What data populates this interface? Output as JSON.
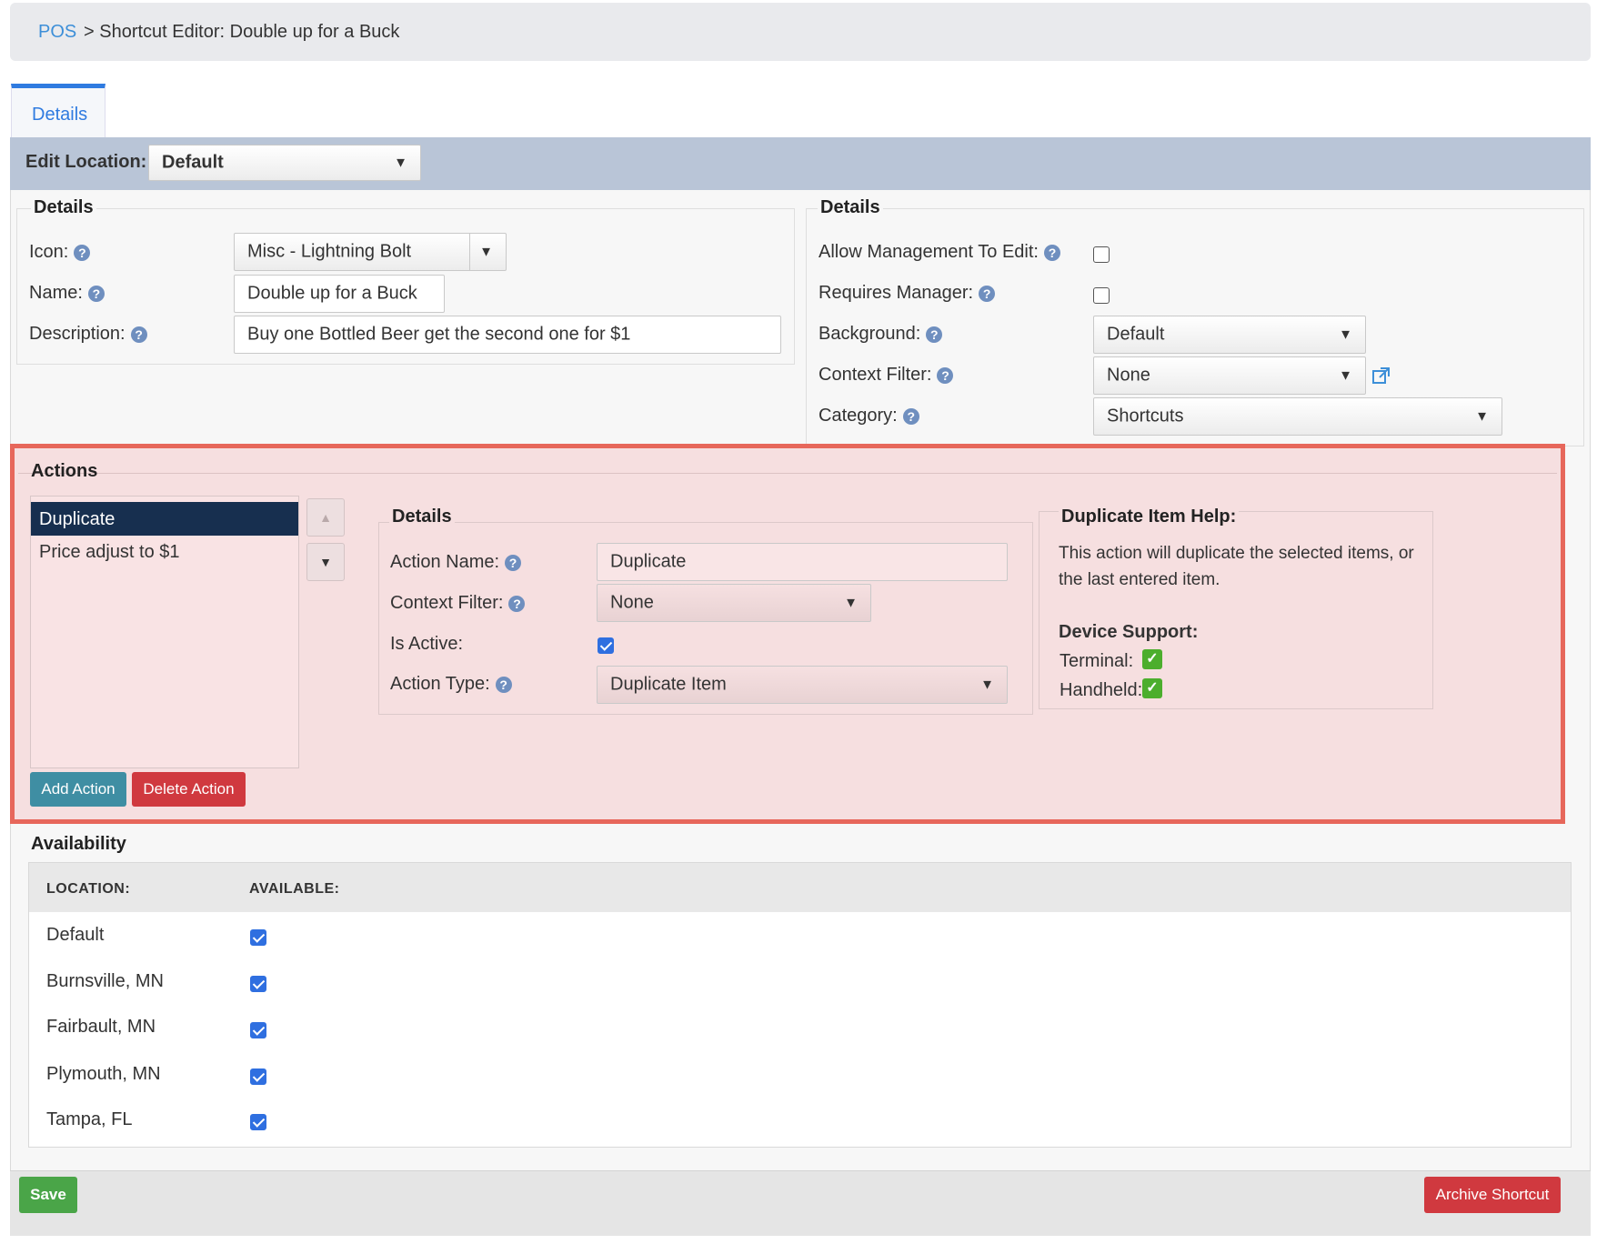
{
  "breadcrumb": {
    "link": "POS",
    "rest": "> Shortcut Editor: Double up for a Buck"
  },
  "tabs": [
    {
      "label": "Details"
    }
  ],
  "edit_location": {
    "label": "Edit Location:",
    "value": "Default"
  },
  "details_left": {
    "legend": "Details",
    "icon_label": "Icon:",
    "icon_value": "Misc - Lightning Bolt",
    "name_label": "Name:",
    "name_value": "Double up for a Buck",
    "description_label": "Description:",
    "description_value": "Buy one Bottled Beer get the second one for $1"
  },
  "details_right": {
    "legend": "Details",
    "allow_mgmt_label": "Allow Management To Edit:",
    "allow_mgmt_checked": false,
    "requires_mgr_label": "Requires Manager:",
    "requires_mgr_checked": false,
    "background_label": "Background:",
    "background_value": "Default",
    "context_filter_label": "Context Filter:",
    "context_filter_value": "None",
    "category_label": "Category:",
    "category_value": "Shortcuts"
  },
  "actions": {
    "legend": "Actions",
    "items": [
      "Duplicate",
      "Price adjust to $1"
    ],
    "selected": "Duplicate",
    "add_label": "Add Action",
    "delete_label": "Delete Action",
    "details": {
      "legend": "Details",
      "action_name_label": "Action Name:",
      "action_name_value": "Duplicate",
      "context_filter_label": "Context Filter:",
      "context_filter_value": "None",
      "is_active_label": "Is Active:",
      "is_active_checked": true,
      "action_type_label": "Action Type:",
      "action_type_value": "Duplicate Item"
    },
    "help": {
      "title": "Duplicate Item Help:",
      "line1": "This action will duplicate the selected items, or",
      "line2": "the last entered item.",
      "device_support": "Device Support:",
      "terminal": "Terminal:",
      "handheld": "Handheld:"
    }
  },
  "availability": {
    "legend": "Availability",
    "col_location": "LOCATION:",
    "col_available": "AVAILABLE:",
    "rows": [
      {
        "location": "Default",
        "available": true
      },
      {
        "location": "Burnsville, MN",
        "available": true
      },
      {
        "location": "Fairbault, MN",
        "available": true
      },
      {
        "location": "Plymouth, MN",
        "available": true
      },
      {
        "location": "Tampa, FL",
        "available": true
      }
    ]
  },
  "footer": {
    "save_label": "Save",
    "archive_label": "Archive Shortcut"
  },
  "colors": {
    "highlight_border": "#e7675b",
    "selected_item": "#172f4f",
    "add_button": "#3f8ea3",
    "delete_button": "#d0393f",
    "save_button": "#4aa548",
    "link": "#3d8fd8"
  }
}
